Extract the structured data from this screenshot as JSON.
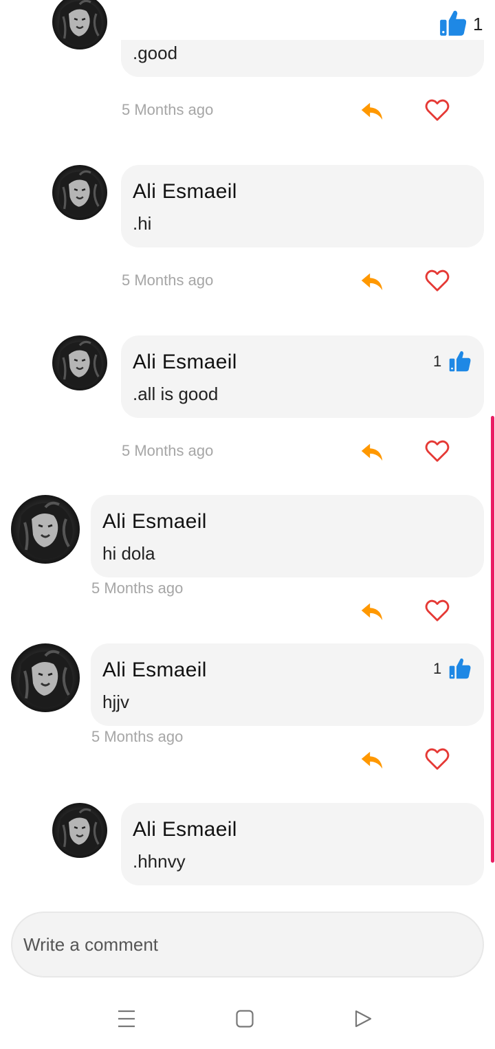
{
  "top": {
    "like_count": "1"
  },
  "comments": [
    {
      "author": "",
      "text": ".good",
      "time": "5 Months ago",
      "likes": ""
    },
    {
      "author": "Ali Esmaeil",
      "text": ".hi",
      "time": "5 Months ago",
      "likes": ""
    },
    {
      "author": "Ali Esmaeil",
      "text": ".all is good",
      "time": "5 Months ago",
      "likes": "1"
    },
    {
      "author": "Ali Esmaeil",
      "text": "hi dola",
      "time": "5 Months ago",
      "likes": ""
    },
    {
      "author": "Ali Esmaeil",
      "text": "hjjv",
      "time": "5 Months ago",
      "likes": "1"
    },
    {
      "author": "Ali Esmaeil",
      "text": ".hhnvy",
      "time": "",
      "likes": ""
    }
  ],
  "composer": {
    "placeholder": "Write a comment"
  },
  "icons": {
    "like": "thumbs-up-icon",
    "reply": "reply-icon",
    "favorite": "heart-icon",
    "nav_menu": "menu-icon",
    "nav_home": "square-icon",
    "nav_back": "triangle-back-icon"
  },
  "colors": {
    "like": "#1e88e5",
    "reply": "#ff9800",
    "heart": "#e53935",
    "bubble": "#f4f4f4",
    "scrollbar": "#e91e63"
  }
}
